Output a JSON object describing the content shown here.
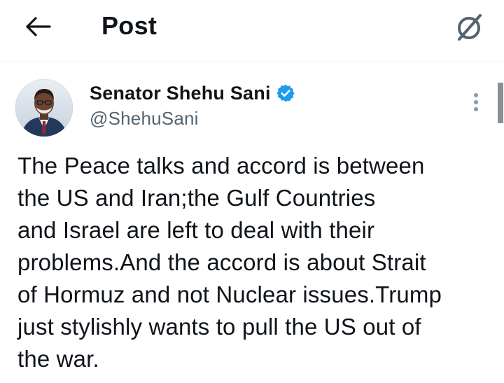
{
  "header": {
    "back_icon": "arrow-left-icon",
    "title": "Post",
    "grok_icon": "grok-icon"
  },
  "post": {
    "author": {
      "name": "Senator Shehu Sani",
      "handle": "@ShehuSani",
      "verified": true,
      "verified_color": "#1d9bf0"
    },
    "more_icon": "more-vertical-icon",
    "text": "The Peace talks and accord is between\nthe US and Iran;the Gulf Countries\nand Israel are left to deal with their\nproblems.And the accord is about Strait\nof Hormuz and not Nuclear issues.Trump\njust stylishly wants to pull the US out of\nthe war."
  },
  "colors": {
    "text_primary": "#0f1419",
    "text_secondary": "#536471",
    "accent": "#1d9bf0"
  }
}
